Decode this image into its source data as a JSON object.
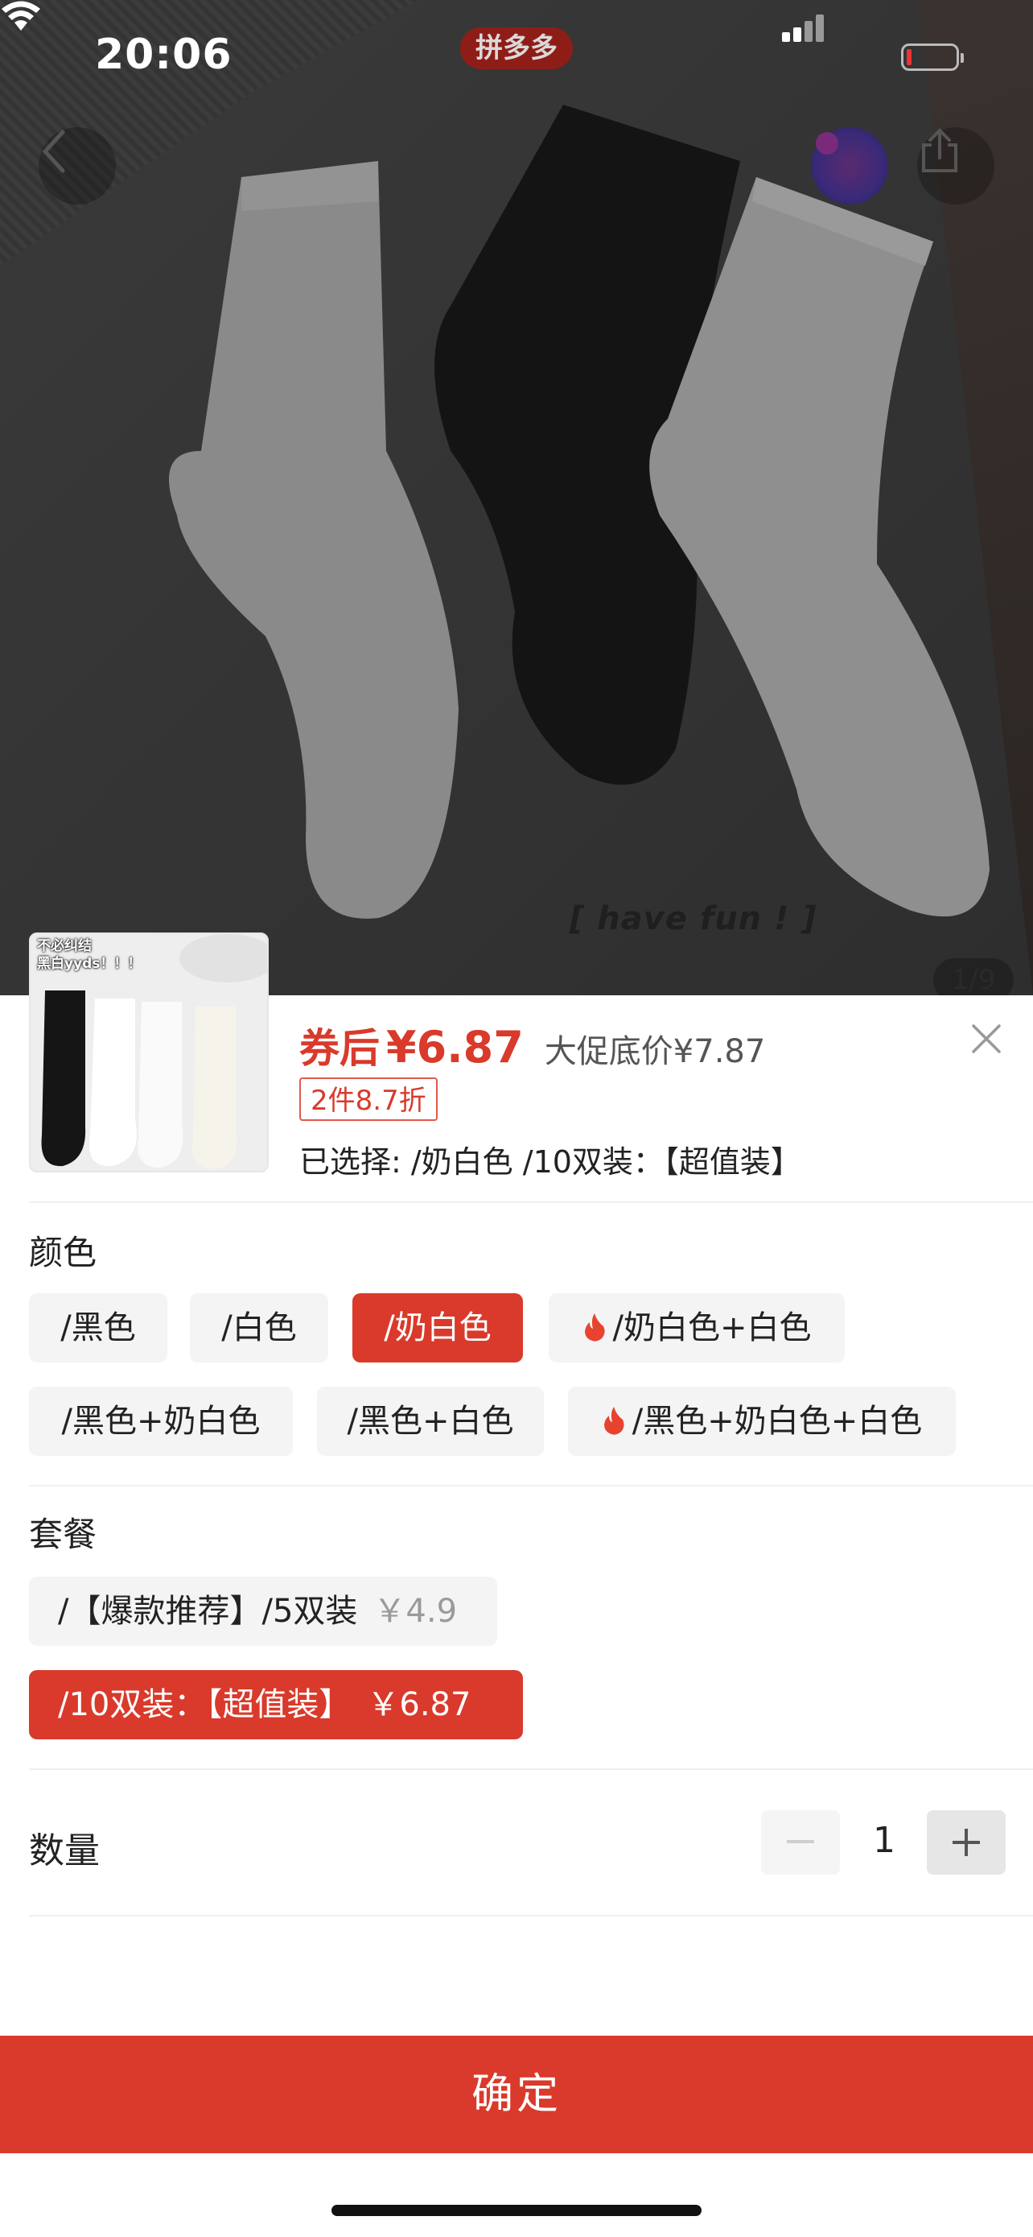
{
  "status_bar": {
    "time": "20:06",
    "app_badge": "拼多多"
  },
  "photo": {
    "overlay_text": "[ have fun ! ]",
    "page_indicator": "1/9"
  },
  "thumbnail": {
    "caption_line1": "不必纠结",
    "caption_line2": "黑白yyds！！！"
  },
  "product": {
    "coupon_label": "券后",
    "price": "¥6.87",
    "promo_price": "大促底价¥7.87",
    "discount_tag": "2件8.7折",
    "selected": "已选择: /奶白色 /10双装：【超值装】"
  },
  "color_section": {
    "title": "颜色",
    "options": [
      {
        "label": "/黑色",
        "selected": false,
        "hot": false
      },
      {
        "label": "/白色",
        "selected": false,
        "hot": false
      },
      {
        "label": "/奶白色",
        "selected": true,
        "hot": false
      },
      {
        "label": "/奶白色+白色",
        "selected": false,
        "hot": true
      },
      {
        "label": "/黑色+奶白色",
        "selected": false,
        "hot": false
      },
      {
        "label": "/黑色+白色",
        "selected": false,
        "hot": false
      },
      {
        "label": "/黑色+奶白色+白色",
        "selected": false,
        "hot": true
      }
    ]
  },
  "package_section": {
    "title": "套餐",
    "options": [
      {
        "label": "/【爆款推荐】/5双装",
        "price": "￥4.9",
        "selected": false
      },
      {
        "label": "/10双装：【超值装】",
        "price": "￥6.87",
        "selected": true
      }
    ]
  },
  "quantity": {
    "label": "数量",
    "value": "1",
    "minus": "−",
    "plus": "+"
  },
  "confirm_button": "确定",
  "colors": {
    "accent": "#d93a2b",
    "chip_bg": "#f4f4f4"
  },
  "icons": [
    "back-icon",
    "chat-icon",
    "share-icon",
    "close-icon",
    "flame-icon",
    "minus-icon",
    "plus-icon"
  ]
}
